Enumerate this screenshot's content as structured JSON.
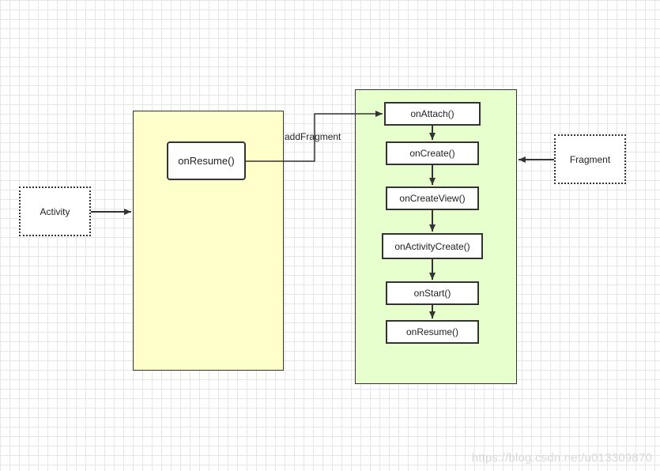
{
  "activity_label": "Activity",
  "fragment_label": "Fragment",
  "activity_panel": {
    "method": "onResume()"
  },
  "edge_label": "addFragment",
  "fragment_panel": {
    "methods": [
      "onAttach()",
      "onCreate()",
      "onCreateView()",
      "onActivityCreate()",
      "onStart()",
      "onResume()"
    ]
  },
  "watermark": "https://blog.csdn.net/u013309870",
  "colors": {
    "activity_panel": "#ffffcc",
    "fragment_panel": "#e6ffcc",
    "stroke": "#333333"
  }
}
